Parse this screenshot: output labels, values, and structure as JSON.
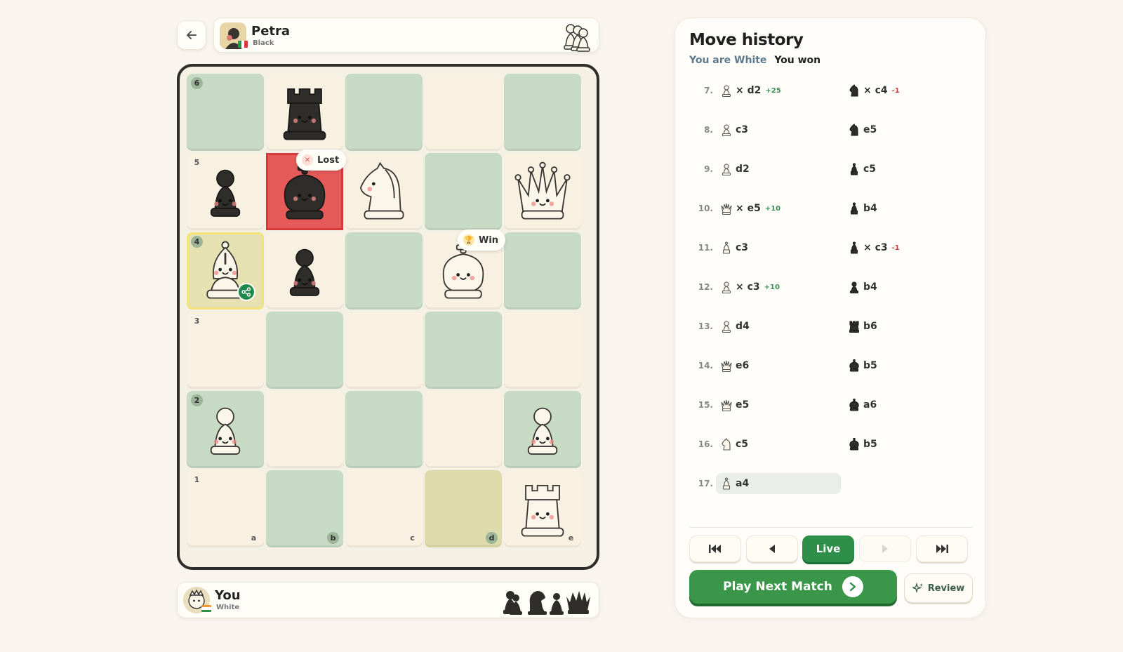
{
  "opponent": {
    "name": "Petra",
    "color_label": "Black",
    "flag": "italy"
  },
  "player": {
    "name": "You",
    "color_label": "White",
    "flag": "india"
  },
  "board": {
    "ranks": [
      "6",
      "5",
      "4",
      "3",
      "2",
      "1"
    ],
    "files": [
      "a",
      "b",
      "c",
      "d",
      "e"
    ],
    "pieces": [
      {
        "square": "b6",
        "piece": "black-rook"
      },
      {
        "square": "a5",
        "piece": "black-pawn"
      },
      {
        "square": "b5",
        "piece": "black-king"
      },
      {
        "square": "c5",
        "piece": "white-knight"
      },
      {
        "square": "e5",
        "piece": "white-queen"
      },
      {
        "square": "a4",
        "piece": "white-bishop"
      },
      {
        "square": "b4",
        "piece": "black-pawn"
      },
      {
        "square": "d4",
        "piece": "white-king"
      },
      {
        "square": "a2",
        "piece": "white-pawn"
      },
      {
        "square": "e2",
        "piece": "white-pawn"
      },
      {
        "square": "e1",
        "piece": "white-rook"
      }
    ],
    "lost_tag": "Lost",
    "win_tag": "Win"
  },
  "move_history": {
    "title": "Move history",
    "you_are": "You are White",
    "result": "You won",
    "moves": [
      {
        "num": "7.",
        "white": {
          "piece": "pawn",
          "text": "d2",
          "capture": true,
          "delta": "+25"
        },
        "black": {
          "piece": "knight",
          "text": "c4",
          "capture": true,
          "delta": "-1"
        }
      },
      {
        "num": "8.",
        "white": {
          "piece": "pawn",
          "text": "c3"
        },
        "black": {
          "piece": "knight",
          "text": "e5"
        }
      },
      {
        "num": "9.",
        "white": {
          "piece": "pawn",
          "text": "d2"
        },
        "black": {
          "piece": "bishop",
          "text": "c5"
        }
      },
      {
        "num": "10.",
        "white": {
          "piece": "queen",
          "text": "e5",
          "capture": true,
          "delta": "+10"
        },
        "black": {
          "piece": "bishop",
          "text": "b4"
        }
      },
      {
        "num": "11.",
        "white": {
          "piece": "bishop",
          "text": "c3"
        },
        "black": {
          "piece": "bishop",
          "text": "c3",
          "capture": true,
          "delta": "-1"
        }
      },
      {
        "num": "12.",
        "white": {
          "piece": "pawn",
          "text": "c3",
          "capture": true,
          "delta": "+10"
        },
        "black": {
          "piece": "pawn",
          "text": "b4"
        }
      },
      {
        "num": "13.",
        "white": {
          "piece": "pawn",
          "text": "d4"
        },
        "black": {
          "piece": "rook",
          "text": "b6"
        }
      },
      {
        "num": "14.",
        "white": {
          "piece": "queen",
          "text": "e6"
        },
        "black": {
          "piece": "king",
          "text": "b5"
        }
      },
      {
        "num": "15.",
        "white": {
          "piece": "queen",
          "text": "e5"
        },
        "black": {
          "piece": "king",
          "text": "a6"
        }
      },
      {
        "num": "16.",
        "white": {
          "piece": "knight",
          "text": "c5"
        },
        "black": {
          "piece": "king",
          "text": "b5"
        }
      },
      {
        "num": "17.",
        "white": {
          "piece": "bishop",
          "text": "a4"
        },
        "black": null
      }
    ]
  },
  "controls": {
    "live_label": "Live",
    "play_next_label": "Play Next Match",
    "review_label": "Review"
  },
  "colors": {
    "background": "#faf4ee",
    "light_square": "#f8f1e2",
    "dark_square": "#c7dac3",
    "accent_green": "#2e8f4a",
    "lost_red": "#e65a5a"
  }
}
